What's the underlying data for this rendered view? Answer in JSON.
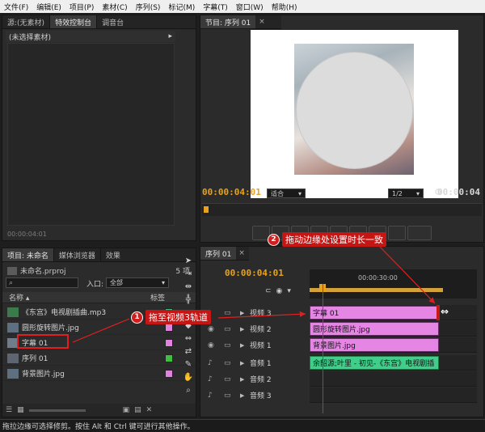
{
  "menu": [
    "文件(F)",
    "编辑(E)",
    "项目(P)",
    "素材(C)",
    "序列(S)",
    "标记(M)",
    "字幕(T)",
    "窗口(W)",
    "帮助(H)"
  ],
  "source_panel": {
    "tabs": [
      "源:(无素材)",
      "特效控制台",
      "调音台"
    ],
    "header": "(未选择素材)",
    "timecode": "00:00:04:01"
  },
  "program": {
    "tab": "节目: 序列 01",
    "timecode_current": "00:00:04:01",
    "zoom": "适合",
    "resolution": "1/2",
    "timecode_duration": "00:00:04"
  },
  "project": {
    "tabs": [
      "项目: 未命名",
      "媒体浏览器",
      "效果"
    ],
    "file": "未命名.prproj",
    "item_count": "5 项",
    "search_placeholder": "",
    "in_label": "入口:",
    "in_value": "全部",
    "col_name": "名称",
    "col_label": "标签",
    "items": [
      {
        "name": "《东宫》电视剧插曲.mp3",
        "color": "#3ec17a",
        "icon": "audio-file-icon"
      },
      {
        "name": "圆形旋转图片.jpg",
        "color": "#e083e0",
        "icon": "image-file-icon"
      },
      {
        "name": "字幕 01",
        "color": "#e083e0",
        "icon": "title-file-icon"
      },
      {
        "name": "序列 01",
        "color": "#3fbf3f",
        "icon": "sequence-icon"
      },
      {
        "name": "背景图片.jpg",
        "color": "#e083e0",
        "icon": "image-file-icon"
      }
    ]
  },
  "sequence": {
    "tab": "序列 01",
    "timecode": "00:00:04:01",
    "ruler_label": "00:00:30:00",
    "tracks": [
      {
        "label": "视频 3",
        "kind": "video",
        "clip": "字幕 01",
        "clip_color": "#e586e5"
      },
      {
        "label": "视频 2",
        "kind": "video",
        "clip": "圆形旋转图片.jpg",
        "clip_color": "#e586e5"
      },
      {
        "label": "视频 1",
        "kind": "video",
        "clip": "背景图片.jpg",
        "clip_color": "#e586e5"
      },
      {
        "label": "音频 1",
        "kind": "audio",
        "clip": "余韶源;叶里 - 初见-《东宫》电视剧插",
        "clip_color": "#3fcf8a"
      },
      {
        "label": "音频 2",
        "kind": "audio",
        "clip": "",
        "clip_color": ""
      },
      {
        "label": "音频 3",
        "kind": "audio",
        "clip": "",
        "clip_color": ""
      }
    ]
  },
  "annotations": {
    "one_number": "1",
    "one_text": "拖至视频3轨道",
    "two_number": "2",
    "two_text": "拖动边缘处设置时长一致",
    "color": "#d11f1f"
  },
  "status": "拖拉边缘可选择修剪。按住 Alt 和 Ctrl 键可进行其他操作。"
}
